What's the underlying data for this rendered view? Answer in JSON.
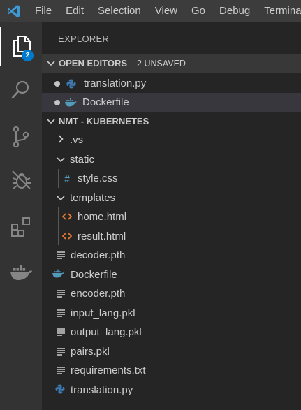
{
  "menu": [
    "File",
    "Edit",
    "Selection",
    "View",
    "Go",
    "Debug",
    "Terminal"
  ],
  "activity": {
    "items": [
      "explorer-icon",
      "search-icon",
      "source-control-icon",
      "debug-icon",
      "extensions-icon",
      "docker-icon"
    ],
    "explorer_badge": "2",
    "accent": "#007acc"
  },
  "sidebar": {
    "title": "EXPLORER",
    "open_editors": {
      "label": "OPEN EDITORS",
      "unsaved": "2 UNSAVED",
      "files": [
        {
          "name": "translation.py",
          "icon": "python-icon"
        },
        {
          "name": "Dockerfile",
          "icon": "docker-icon"
        }
      ]
    },
    "project": {
      "label": "NMT - KUBERNETES",
      "items": [
        {
          "name": ".vs",
          "type": "folder-collapsed"
        },
        {
          "name": "static",
          "type": "folder-expanded"
        },
        {
          "name": "style.css",
          "type": "css-file"
        },
        {
          "name": "templates",
          "type": "folder-expanded"
        },
        {
          "name": "home.html",
          "type": "html-file"
        },
        {
          "name": "result.html",
          "type": "html-file"
        },
        {
          "name": "decoder.pth",
          "type": "file"
        },
        {
          "name": "Dockerfile",
          "type": "docker-file"
        },
        {
          "name": "encoder.pth",
          "type": "file"
        },
        {
          "name": "input_lang.pkl",
          "type": "file"
        },
        {
          "name": "output_lang.pkl",
          "type": "file"
        },
        {
          "name": "pairs.pkl",
          "type": "file"
        },
        {
          "name": "requirements.txt",
          "type": "file"
        },
        {
          "name": "translation.py",
          "type": "python-file"
        }
      ]
    }
  }
}
